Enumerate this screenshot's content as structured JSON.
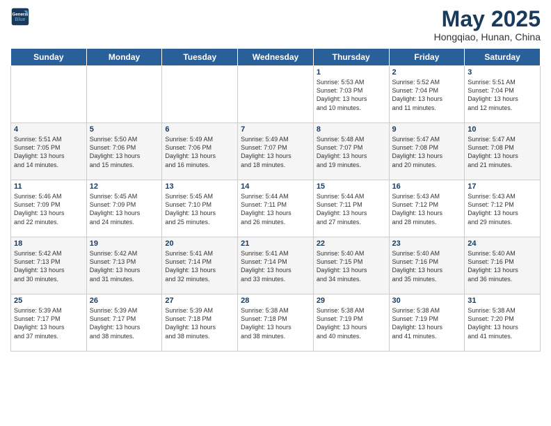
{
  "header": {
    "logo_line1": "General",
    "logo_line2": "Blue",
    "month": "May 2025",
    "location": "Hongqiao, Hunan, China"
  },
  "weekdays": [
    "Sunday",
    "Monday",
    "Tuesday",
    "Wednesday",
    "Thursday",
    "Friday",
    "Saturday"
  ],
  "weeks": [
    [
      {
        "num": "",
        "info": ""
      },
      {
        "num": "",
        "info": ""
      },
      {
        "num": "",
        "info": ""
      },
      {
        "num": "",
        "info": ""
      },
      {
        "num": "1",
        "info": "Sunrise: 5:53 AM\nSunset: 7:03 PM\nDaylight: 13 hours\nand 10 minutes."
      },
      {
        "num": "2",
        "info": "Sunrise: 5:52 AM\nSunset: 7:04 PM\nDaylight: 13 hours\nand 11 minutes."
      },
      {
        "num": "3",
        "info": "Sunrise: 5:51 AM\nSunset: 7:04 PM\nDaylight: 13 hours\nand 12 minutes."
      }
    ],
    [
      {
        "num": "4",
        "info": "Sunrise: 5:51 AM\nSunset: 7:05 PM\nDaylight: 13 hours\nand 14 minutes."
      },
      {
        "num": "5",
        "info": "Sunrise: 5:50 AM\nSunset: 7:06 PM\nDaylight: 13 hours\nand 15 minutes."
      },
      {
        "num": "6",
        "info": "Sunrise: 5:49 AM\nSunset: 7:06 PM\nDaylight: 13 hours\nand 16 minutes."
      },
      {
        "num": "7",
        "info": "Sunrise: 5:49 AM\nSunset: 7:07 PM\nDaylight: 13 hours\nand 18 minutes."
      },
      {
        "num": "8",
        "info": "Sunrise: 5:48 AM\nSunset: 7:07 PM\nDaylight: 13 hours\nand 19 minutes."
      },
      {
        "num": "9",
        "info": "Sunrise: 5:47 AM\nSunset: 7:08 PM\nDaylight: 13 hours\nand 20 minutes."
      },
      {
        "num": "10",
        "info": "Sunrise: 5:47 AM\nSunset: 7:08 PM\nDaylight: 13 hours\nand 21 minutes."
      }
    ],
    [
      {
        "num": "11",
        "info": "Sunrise: 5:46 AM\nSunset: 7:09 PM\nDaylight: 13 hours\nand 22 minutes."
      },
      {
        "num": "12",
        "info": "Sunrise: 5:45 AM\nSunset: 7:09 PM\nDaylight: 13 hours\nand 24 minutes."
      },
      {
        "num": "13",
        "info": "Sunrise: 5:45 AM\nSunset: 7:10 PM\nDaylight: 13 hours\nand 25 minutes."
      },
      {
        "num": "14",
        "info": "Sunrise: 5:44 AM\nSunset: 7:11 PM\nDaylight: 13 hours\nand 26 minutes."
      },
      {
        "num": "15",
        "info": "Sunrise: 5:44 AM\nSunset: 7:11 PM\nDaylight: 13 hours\nand 27 minutes."
      },
      {
        "num": "16",
        "info": "Sunrise: 5:43 AM\nSunset: 7:12 PM\nDaylight: 13 hours\nand 28 minutes."
      },
      {
        "num": "17",
        "info": "Sunrise: 5:43 AM\nSunset: 7:12 PM\nDaylight: 13 hours\nand 29 minutes."
      }
    ],
    [
      {
        "num": "18",
        "info": "Sunrise: 5:42 AM\nSunset: 7:13 PM\nDaylight: 13 hours\nand 30 minutes."
      },
      {
        "num": "19",
        "info": "Sunrise: 5:42 AM\nSunset: 7:13 PM\nDaylight: 13 hours\nand 31 minutes."
      },
      {
        "num": "20",
        "info": "Sunrise: 5:41 AM\nSunset: 7:14 PM\nDaylight: 13 hours\nand 32 minutes."
      },
      {
        "num": "21",
        "info": "Sunrise: 5:41 AM\nSunset: 7:14 PM\nDaylight: 13 hours\nand 33 minutes."
      },
      {
        "num": "22",
        "info": "Sunrise: 5:40 AM\nSunset: 7:15 PM\nDaylight: 13 hours\nand 34 minutes."
      },
      {
        "num": "23",
        "info": "Sunrise: 5:40 AM\nSunset: 7:16 PM\nDaylight: 13 hours\nand 35 minutes."
      },
      {
        "num": "24",
        "info": "Sunrise: 5:40 AM\nSunset: 7:16 PM\nDaylight: 13 hours\nand 36 minutes."
      }
    ],
    [
      {
        "num": "25",
        "info": "Sunrise: 5:39 AM\nSunset: 7:17 PM\nDaylight: 13 hours\nand 37 minutes."
      },
      {
        "num": "26",
        "info": "Sunrise: 5:39 AM\nSunset: 7:17 PM\nDaylight: 13 hours\nand 38 minutes."
      },
      {
        "num": "27",
        "info": "Sunrise: 5:39 AM\nSunset: 7:18 PM\nDaylight: 13 hours\nand 38 minutes."
      },
      {
        "num": "28",
        "info": "Sunrise: 5:38 AM\nSunset: 7:18 PM\nDaylight: 13 hours\nand 38 minutes."
      },
      {
        "num": "29",
        "info": "Sunrise: 5:38 AM\nSunset: 7:19 PM\nDaylight: 13 hours\nand 40 minutes."
      },
      {
        "num": "30",
        "info": "Sunrise: 5:38 AM\nSunset: 7:19 PM\nDaylight: 13 hours\nand 41 minutes."
      },
      {
        "num": "31",
        "info": "Sunrise: 5:38 AM\nSunset: 7:20 PM\nDaylight: 13 hours\nand 41 minutes."
      }
    ]
  ]
}
